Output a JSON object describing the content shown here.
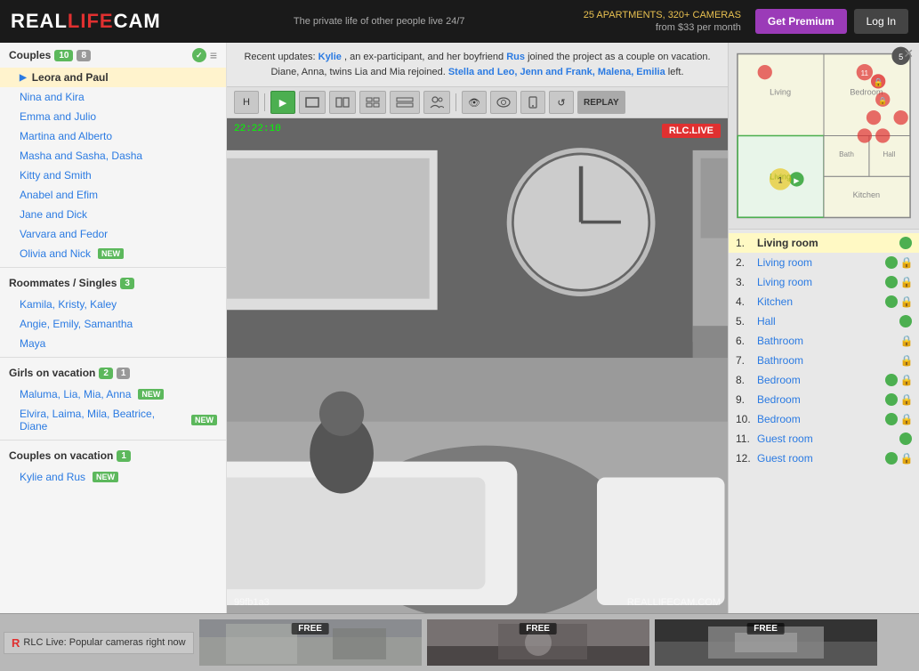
{
  "header": {
    "logo_text": "REALLIFECAM",
    "tagline": "The private life of other people live 24/7",
    "apt_info_line1": "25 APARTMENTS, 320+ CAMERAS",
    "apt_info_line2": "from $33 per month",
    "btn_premium": "Get Premium",
    "btn_login": "Log In"
  },
  "sidebar": {
    "section_couples": "Couples",
    "badge_couples_green": "10",
    "badge_couples_gray": "8",
    "couples": [
      {
        "label": "Leora and Paul",
        "active": true,
        "arrow": true
      },
      {
        "label": "Nina and Kira"
      },
      {
        "label": "Emma and Julio"
      },
      {
        "label": "Martina and Alberto"
      },
      {
        "label": "Masha and Sasha, Dasha"
      },
      {
        "label": "Kitty and Smith"
      },
      {
        "label": "Anabel and Efim"
      },
      {
        "label": "Jane and Dick"
      },
      {
        "label": "Varvara and Fedor"
      },
      {
        "label": "Olivia and Nick",
        "badge_new": true
      }
    ],
    "section_roommates": "Roommates / Singles",
    "badge_roommates": "3",
    "roommates": [
      {
        "label": "Kamila, Kristy, Kaley"
      },
      {
        "label": "Angie, Emily, Samantha"
      },
      {
        "label": "Maya"
      }
    ],
    "section_girls": "Girls on vacation",
    "badge_girls_green": "2",
    "badge_girls_gray": "1",
    "girls": [
      {
        "label": "Maluma, Lia, Mia, Anna",
        "badge_new": true
      },
      {
        "label": "Elvira, Laima, Mila, Beatrice, Diane",
        "badge_new": true
      }
    ],
    "section_couples_vac": "Couples on vacation",
    "badge_couples_vac": "1",
    "couples_vac": [
      {
        "label": "Kylie and Rus",
        "badge_new": true
      }
    ]
  },
  "news_bar": {
    "text_pre": "Recent updates: ",
    "kylie": "Kylie",
    "text1": ", an ex-participant, and her boyfriend ",
    "rus": "Rus",
    "text2": " joined the project as a couple on vacation. ",
    "text3": "Diane, Anna, twins Lia and Mia rejoined. ",
    "stella": "Stella and Leo, Jenn and Frank, Malena, Emilia",
    "text4": " left."
  },
  "camera": {
    "timestamp": "22:22:10",
    "live_badge": "RLC.LIVE",
    "cam_id": "99fb1a3",
    "watermark": "REALLIFECAM.COM"
  },
  "toolbar": {
    "buttons": [
      "H",
      "",
      "",
      "",
      "",
      "",
      "",
      "",
      "",
      "",
      "REPLAY"
    ]
  },
  "room_list": {
    "rooms": [
      {
        "num": "1.",
        "name": "Living room",
        "sound": true,
        "lock": false,
        "active": true
      },
      {
        "num": "2.",
        "name": "Living room",
        "sound": true,
        "lock": true
      },
      {
        "num": "3.",
        "name": "Living room",
        "sound": true,
        "lock": true
      },
      {
        "num": "4.",
        "name": "Kitchen",
        "sound": true,
        "lock": true
      },
      {
        "num": "5.",
        "name": "Hall",
        "sound": true,
        "lock": false
      },
      {
        "num": "6.",
        "name": "Bathroom",
        "sound": false,
        "lock": true
      },
      {
        "num": "7.",
        "name": "Bathroom",
        "sound": false,
        "lock": true
      },
      {
        "num": "8.",
        "name": "Bedroom",
        "sound": true,
        "lock": true
      },
      {
        "num": "9.",
        "name": "Bedroom",
        "sound": true,
        "lock": true
      },
      {
        "num": "10.",
        "name": "Bedroom",
        "sound": true,
        "lock": true
      },
      {
        "num": "11.",
        "name": "Guest room",
        "sound": true,
        "lock": false
      },
      {
        "num": "12.",
        "name": "Guest room",
        "sound": true,
        "lock": true
      }
    ]
  },
  "bottom_bar": {
    "label_icon": "▶",
    "label_text": "RLC Live: Popular cameras right now",
    "thumbs": [
      {
        "free": "FREE"
      },
      {
        "free": "FREE"
      },
      {
        "free": "FREE"
      }
    ]
  }
}
